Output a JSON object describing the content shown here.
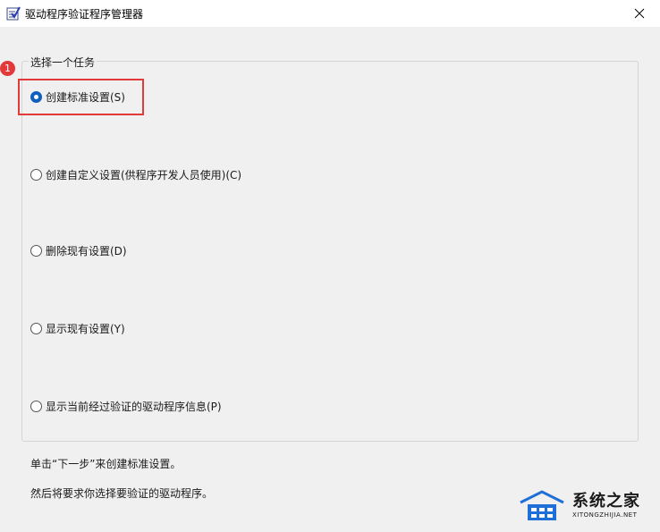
{
  "window": {
    "title": "驱动程序验证程序管理器",
    "close_label": "✕"
  },
  "task_group": {
    "legend": "选择一个任务",
    "options": [
      {
        "label": "创建标准设置(S)",
        "selected": true
      },
      {
        "label": "创建自定义设置(供程序开发人员使用)(C)",
        "selected": false
      },
      {
        "label": "删除现有设置(D)",
        "selected": false
      },
      {
        "label": "显示现有设置(Y)",
        "selected": false
      },
      {
        "label": "显示当前经过验证的驱动程序信息(P)",
        "selected": false
      }
    ]
  },
  "annotation": {
    "step_number": "1",
    "highlight_color": "#e23a3a"
  },
  "instructions": {
    "line1": "单击“下一步”来创建标准设置。",
    "line2": "然后将要求你选择要验证的驱动程序。"
  },
  "watermark": {
    "name": "系统之家",
    "url": "XITONGZHIJIA.NET"
  },
  "colors": {
    "accent": "#0f5fbf",
    "background": "#f0f0f0"
  }
}
